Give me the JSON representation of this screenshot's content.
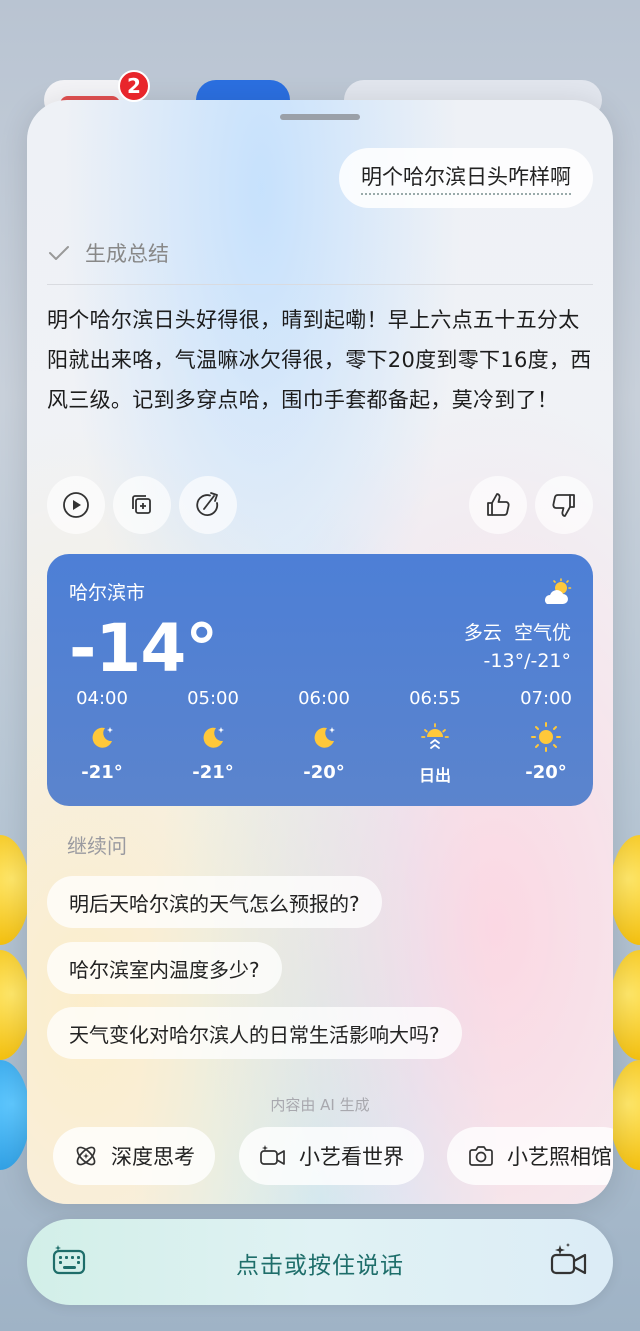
{
  "background": {
    "badge_count": "2"
  },
  "user_message": "明个哈尔滨日头咋样啊",
  "summary": {
    "label": "生成总结"
  },
  "answer": "明个哈尔滨日头好得很，晴到起嘞！早上六点五十五分太阳就出来咯，气温嘛冰欠得很，零下20度到零下16度，西风三级。记到多穿点哈，围巾手套都备起，莫冷到了！",
  "actions": [
    {
      "name": "play-icon"
    },
    {
      "name": "copy-icon"
    },
    {
      "name": "share-icon"
    },
    {
      "name": "thumbs-up-icon"
    },
    {
      "name": "thumbs-down-icon"
    }
  ],
  "weather": {
    "city": "哈尔滨市",
    "temperature": "-14°",
    "condition": "多云  空气优",
    "range": "-13°/-21°",
    "hours": [
      {
        "time": "04:00",
        "icon": "moon-icon",
        "value": "-21°"
      },
      {
        "time": "05:00",
        "icon": "moon-icon",
        "value": "-21°"
      },
      {
        "time": "06:00",
        "icon": "moon-icon",
        "value": "-20°"
      },
      {
        "time": "06:55",
        "icon": "sunrise-icon",
        "value": "日出"
      },
      {
        "time": "07:00",
        "icon": "sun-icon",
        "value": "-20°"
      }
    ],
    "colors": {
      "card": "#4d7fd6",
      "sun": "#ffc83a"
    }
  },
  "follow_up": {
    "title": "继续问",
    "suggestions": [
      "明后天哈尔滨的天气怎么预报的?",
      "哈尔滨室内温度多少?",
      "天气变化对哈尔滨人的日常生活影响大吗?"
    ]
  },
  "ai_note": "内容由 AI 生成",
  "chips": [
    {
      "label": "深度思考",
      "icon": "atom-icon"
    },
    {
      "label": "小艺看世界",
      "icon": "video-sparkle-icon"
    },
    {
      "label": "小艺照相馆",
      "icon": "camera-icon"
    }
  ],
  "voice": {
    "label": "点击或按住说话"
  }
}
